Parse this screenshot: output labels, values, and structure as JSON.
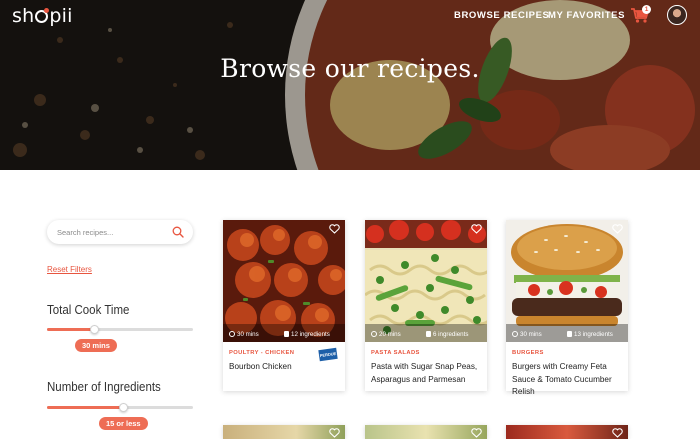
{
  "header": {
    "logo": "shopii",
    "nav": [
      {
        "label": "BROWSE RECIPES"
      },
      {
        "label": "MY FAVORITES"
      }
    ],
    "cart_count": "1"
  },
  "hero": {
    "title": "Browse our recipes."
  },
  "sidebar": {
    "search_placeholder": "Search recipes...",
    "reset_label": "Reset Filters",
    "filters": [
      {
        "title": "Total Cook Time",
        "value_label": "30 mins",
        "level": 0.32
      },
      {
        "title": "Number of Ingredients",
        "value_label": "15 or less",
        "level": 0.52
      }
    ]
  },
  "recipes": [
    {
      "category": "POULTRY - CHICKEN",
      "title": "Bourbon Chicken",
      "time": "30 mins",
      "ingredients": "12 ingredients",
      "badge": "PERDUE"
    },
    {
      "category": "PASTA SALADS",
      "title": "Pasta with Sugar Snap Peas, Asparagus and Parmesan",
      "time": "20 mins",
      "ingredients": "6 ingredients"
    },
    {
      "category": "BURGERS",
      "title": "Burgers with Creamy Feta Sauce & Tomato Cucumber Relish",
      "time": "30 mins",
      "ingredients": "13 ingredients"
    }
  ],
  "colors": {
    "accent": "#e8553f",
    "slider_fill": "#ee6d55",
    "badge_blue": "#1d5fa8"
  },
  "icons": {
    "search": "search-icon",
    "cart": "cart-icon",
    "heart": "heart-icon",
    "clock": "clock-icon",
    "ingredients": "list-icon"
  }
}
